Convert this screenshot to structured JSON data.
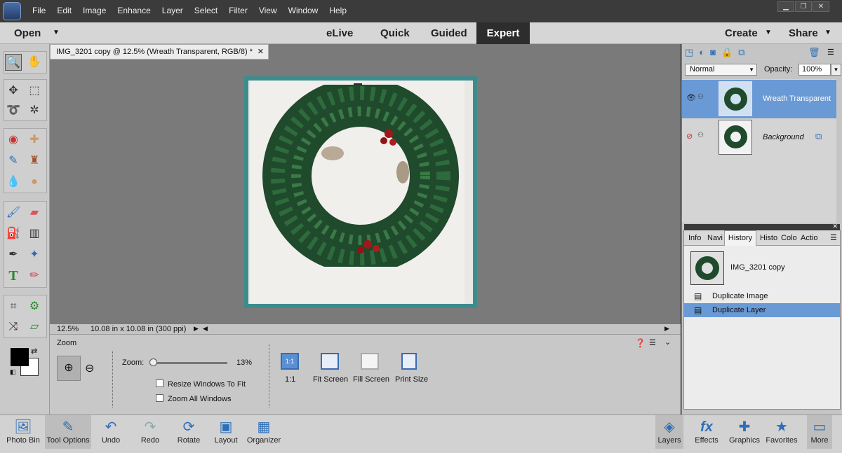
{
  "menubar": {
    "items": [
      "File",
      "Edit",
      "Image",
      "Enhance",
      "Layer",
      "Select",
      "Filter",
      "View",
      "Window",
      "Help"
    ]
  },
  "modebar": {
    "open": "Open",
    "modes": [
      "eLive",
      "Quick",
      "Guided",
      "Expert"
    ],
    "create": "Create",
    "share": "Share"
  },
  "document": {
    "tab_title": "IMG_3201 copy @ 12.5% (Wreath Transparent, RGB/8) *",
    "zoom_status": "12.5%",
    "size_status": "10.08 in x 10.08 in (300 ppi)"
  },
  "tool_options": {
    "title": "Zoom",
    "zoom_label": "Zoom:",
    "zoom_value": "13%",
    "zoom_fraction": 0.04,
    "resize_windows": "Resize Windows To Fit",
    "zoom_all": "Zoom All Windows",
    "buttons": [
      "1:1",
      "Fit Screen",
      "Fill Screen",
      "Print Size"
    ],
    "one_to_one_icon": "1:1"
  },
  "layers": {
    "blend_mode": "Normal",
    "opacity_label": "Opacity:",
    "opacity_value": "100%",
    "items": [
      {
        "name": "Wreath Transparent",
        "selected": true
      },
      {
        "name": "Background",
        "selected": false
      }
    ]
  },
  "history": {
    "tabs": [
      "Info",
      "Navi",
      "History",
      "Histo",
      "Colo",
      "Actio"
    ],
    "snapshot": "IMG_3201 copy",
    "steps": [
      "Duplicate Image",
      "Duplicate Layer"
    ]
  },
  "bottombar": {
    "left": [
      "Photo Bin",
      "Tool Options",
      "Undo",
      "Redo",
      "Rotate",
      "Layout",
      "Organizer"
    ],
    "right": [
      "Layers",
      "Effects",
      "Graphics",
      "Favorites",
      "More"
    ]
  },
  "colors": {
    "accent": "#5b8fd4",
    "selected_layer": "#6a9ad6",
    "door_frame": "#3d8c8d",
    "wreath": "#1f4a2c"
  }
}
